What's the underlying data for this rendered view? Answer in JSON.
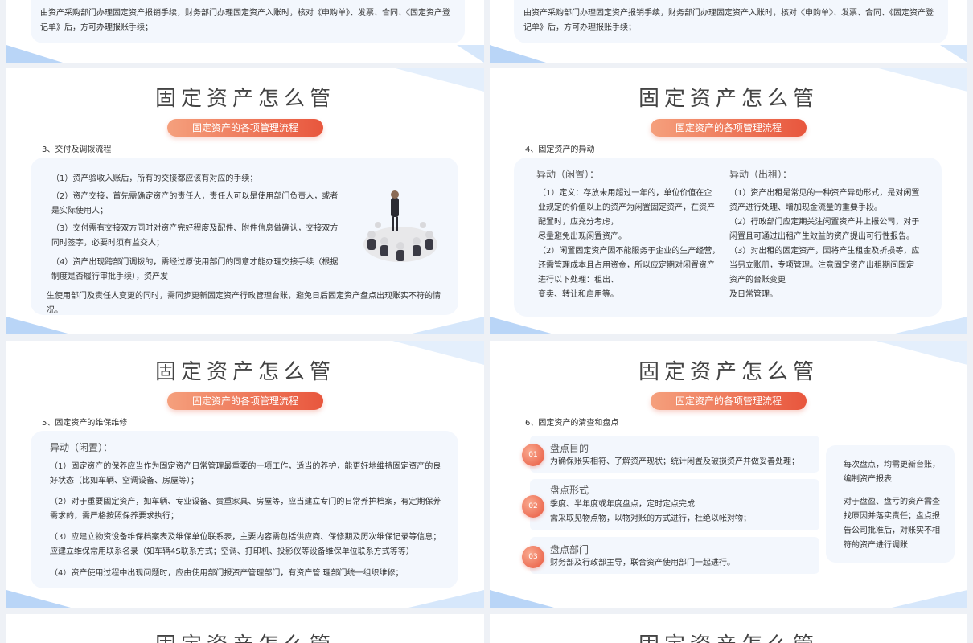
{
  "common": {
    "title": "固定资产怎么管",
    "pill": "固定资产的各项管理流程"
  },
  "top_slides": {
    "text": "由资产采购部门办理固定资产报销手续，财务部门办理固定资产入账时，核对《申购单》、发票、合同、《固定资产登记单》后，方可办理报账手续；"
  },
  "slide3": {
    "heading": "3、交付及调拨流程",
    "items": [
      "（1）资产验收入账后，所有的交接都应该有对应的手续；",
      "（2）资产交接，首先需确定资产的责任人，责任人可以是使用部门负责人，或者是实际使用人；",
      "（3）交付需有交接双方同时对资产完好程度及配件、附件信息做确认，交接双方同时签字，必要时须有监交人；",
      "（4）资产出现跨部门调拨的，需经过原使用部门的同意才能办理交接手续（根据制度是否履行审批手续），资产发",
      "生使用部门及责任人变更的同时，需同步更新固定资产行政管理台账，避免日后固定资产盘点出现账实不符的情况。"
    ]
  },
  "slide4": {
    "heading": "4、固定资产的异动",
    "left_title": "异动（闲置）：",
    "left_lines": [
      "（1）定义：存放未用超过一年的，单位价值在企",
      "业规定的价值以上的资产为闲置固定资产，在资产",
      "配置时，应充分考虑，",
      "尽量避免出现闲置资产。",
      "（2）闲置固定资产因不能服务于企业的生产经营，",
      "还需管理成本且占用资金，所以应定期对闲置资产",
      "进行以下处理：租出、",
      "变卖、转让和启用等。"
    ],
    "right_title": "异动（出租）：",
    "right_lines": [
      "（1）资产出租是常见的一种资产异动形式，是对闲置",
      "资产进行处理、增加现金流量的重要手段。",
      "（2）行政部门应定期关注闲置资产并上报公司，对于",
      "闲置且可通过出租产生效益的资产提出可行性报告。",
      "（3）对出租的固定资产，因将产生租金及折损等，应",
      "当另立账册，专项管理。注意固定资产出租期间固定",
      "资产的台账变更",
      "及日常管理。"
    ]
  },
  "slide5": {
    "heading": "5、固定资产的维保维修",
    "sub": "异动（闲置）：",
    "items": [
      "（1）固定资产的保养应当作为固定资产日常管理最重要的一项工作，适当的养护，能更好地维持固定资产的良好状态（比如车辆、空调设备、房屋等）；",
      "（2）对于重要固定资产，如车辆、专业设备、贵重家具、房屋等，应当建立专门的日常养护档案，有定期保养需求的，需严格按照保养要求执行；",
      "（3）应建立物资设备维保档案表及维保单位联系表，主要内容需包括供应商、保修期及历次维保记录等信息；应建立维保常用联系名录（如车辆4S联系方式；空调、打印机、投影仪等设备维保单位联系方式等等）",
      "（4）资产使用过程中出现问题时，应由使用部门报资产管理部门，有资产管 理部门统一组织维修；"
    ]
  },
  "slide6": {
    "heading": "6、固定资产的清查和盘点",
    "items": [
      {
        "num": "01",
        "title": "盘点目的",
        "text": "为确保账实相符、了解资产现状；统计闲置及破损资产并做妥善处理；"
      },
      {
        "num": "02",
        "title": "盘点形式",
        "text": "季度、半年度或年度盘点，定时定点完成\n需采取见物点物，以物对账的方式进行，杜绝以帐对物；"
      },
      {
        "num": "03",
        "title": "盘点部门",
        "text": "财务部及行政部主导，联合资产使用部门一起进行。"
      }
    ],
    "side_text_1": "每次盘点，均需更新台账，编制资产报表",
    "side_text_2": "对于盘盈、盘亏的资产需查找原因并落实责任；盘点报告公司批准后，对账实不相符的资产进行调账"
  }
}
